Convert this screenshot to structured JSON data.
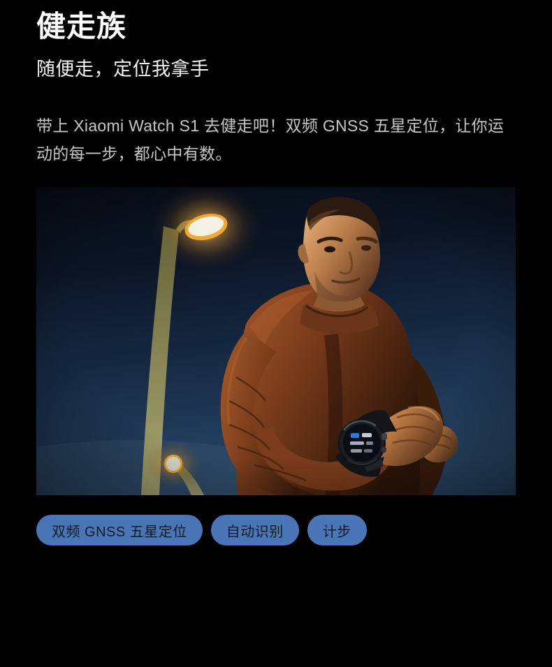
{
  "section": {
    "headline": "健走族",
    "subhead": "随便走，定位我拿手",
    "body": "带上 Xiaomi Watch S1 去健走吧！双频 GNSS 五星定位，让你运动的每一步，都心中有数。"
  },
  "photo": {
    "alt": "夜晚在路灯下跑步的男士，手腕佩戴 Xiaomi Watch S1",
    "scene": "night-runner-with-streetlamps",
    "colors": {
      "sky_top": "#0b1220",
      "sky_horizon": "#25415f",
      "lamp_glow": "#ffe8a8",
      "lamp_halo": "#e8a13a",
      "pole": "#8e8a52",
      "apparel": "#8a4a22",
      "skin": "#c98a53",
      "watch_face": "#12161f",
      "watch_accent": "#2f7fe0"
    }
  },
  "tags": [
    {
      "label": "双频 GNSS 五星定位"
    },
    {
      "label": "自动识别"
    },
    {
      "label": "计步"
    }
  ],
  "theme": {
    "background": "#000000",
    "pill_background": "#4a76b8",
    "pill_text": "#111a26",
    "headline_color": "#ffffff",
    "body_color": "#c6c6c6"
  }
}
